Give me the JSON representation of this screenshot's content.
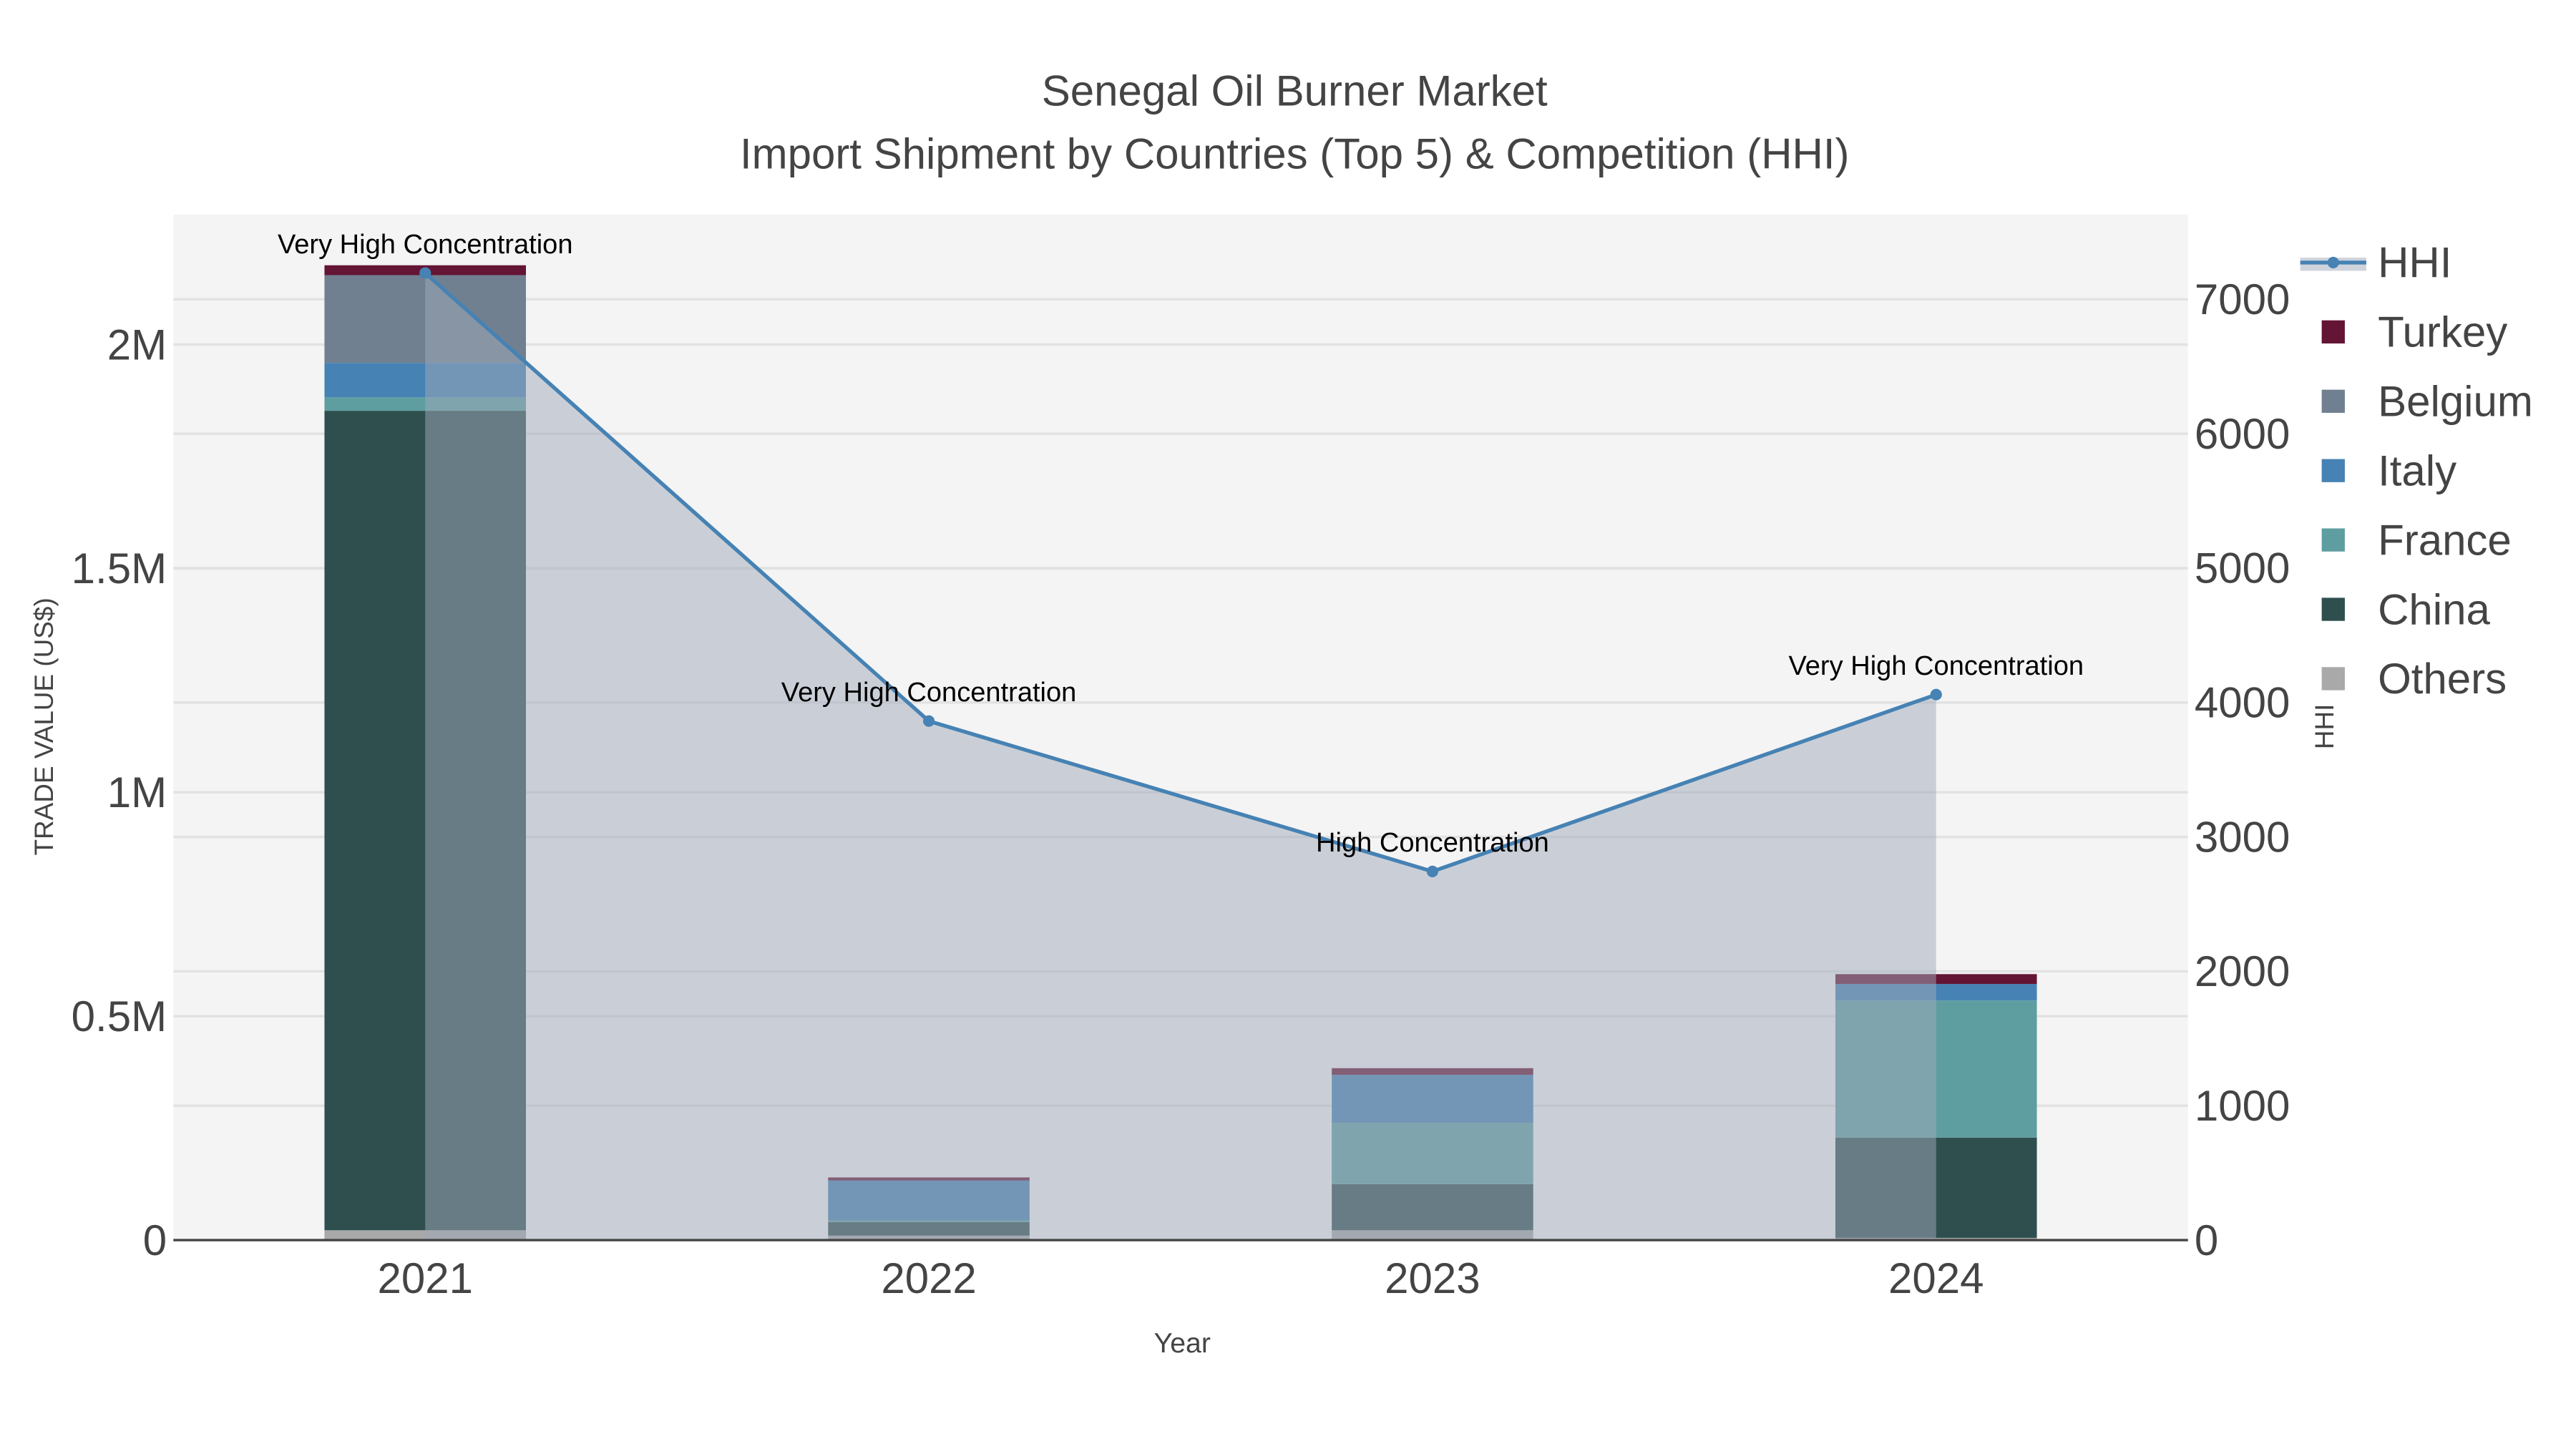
{
  "chart_data": {
    "type": "bar",
    "title": "Senegal Oil Burner Market",
    "subtitle": "Import Shipment by Countries (Top 5) & Competition (HHI)",
    "xlabel": "Year",
    "ylabel": "TRADE VALUE (US$)",
    "y2label": "HHI",
    "categories": [
      "2021",
      "2022",
      "2023",
      "2024"
    ],
    "ylim": [
      0,
      2290000
    ],
    "y2lim": [
      0,
      7630
    ],
    "yticks": [
      {
        "v": 0,
        "label": "0"
      },
      {
        "v": 500000,
        "label": "0.5M"
      },
      {
        "v": 1000000,
        "label": "1M"
      },
      {
        "v": 1500000,
        "label": "1.5M"
      },
      {
        "v": 2000000,
        "label": "2M"
      }
    ],
    "y2ticks": [
      {
        "v": 0,
        "label": "0"
      },
      {
        "v": 1000,
        "label": "1000"
      },
      {
        "v": 2000,
        "label": "2000"
      },
      {
        "v": 3000,
        "label": "3000"
      },
      {
        "v": 4000,
        "label": "4000"
      },
      {
        "v": 5000,
        "label": "5000"
      },
      {
        "v": 6000,
        "label": "6000"
      },
      {
        "v": 7000,
        "label": "7000"
      }
    ],
    "series": [
      {
        "name": "Others",
        "color": "#a9a9a9",
        "values": [
          22000,
          10000,
          22000,
          5000
        ]
      },
      {
        "name": "China",
        "color": "#2f4f4f",
        "values": [
          1830000,
          30000,
          103000,
          224000
        ]
      },
      {
        "name": "France",
        "color": "#5f9ea0",
        "values": [
          30000,
          4000,
          137000,
          306000
        ]
      },
      {
        "name": "Italy",
        "color": "#4682b4",
        "values": [
          77000,
          89000,
          107000,
          37000
        ]
      },
      {
        "name": "Belgium",
        "color": "#708090",
        "values": [
          196000,
          0,
          0,
          0
        ]
      },
      {
        "name": "Turkey",
        "color": "#641434",
        "values": [
          22000,
          7000,
          15000,
          22000
        ]
      }
    ],
    "line": {
      "name": "HHI",
      "color": "#4682b4",
      "values": [
        7196,
        3862,
        2743,
        4059
      ],
      "annotations": [
        "Very High Concentration",
        "Very High Concentration",
        "High Concentration",
        "Very High Concentration"
      ]
    },
    "legend_order": [
      "HHI",
      "Turkey",
      "Belgium",
      "Italy",
      "France",
      "China",
      "Others"
    ],
    "legend_position": "right",
    "grid": true
  }
}
